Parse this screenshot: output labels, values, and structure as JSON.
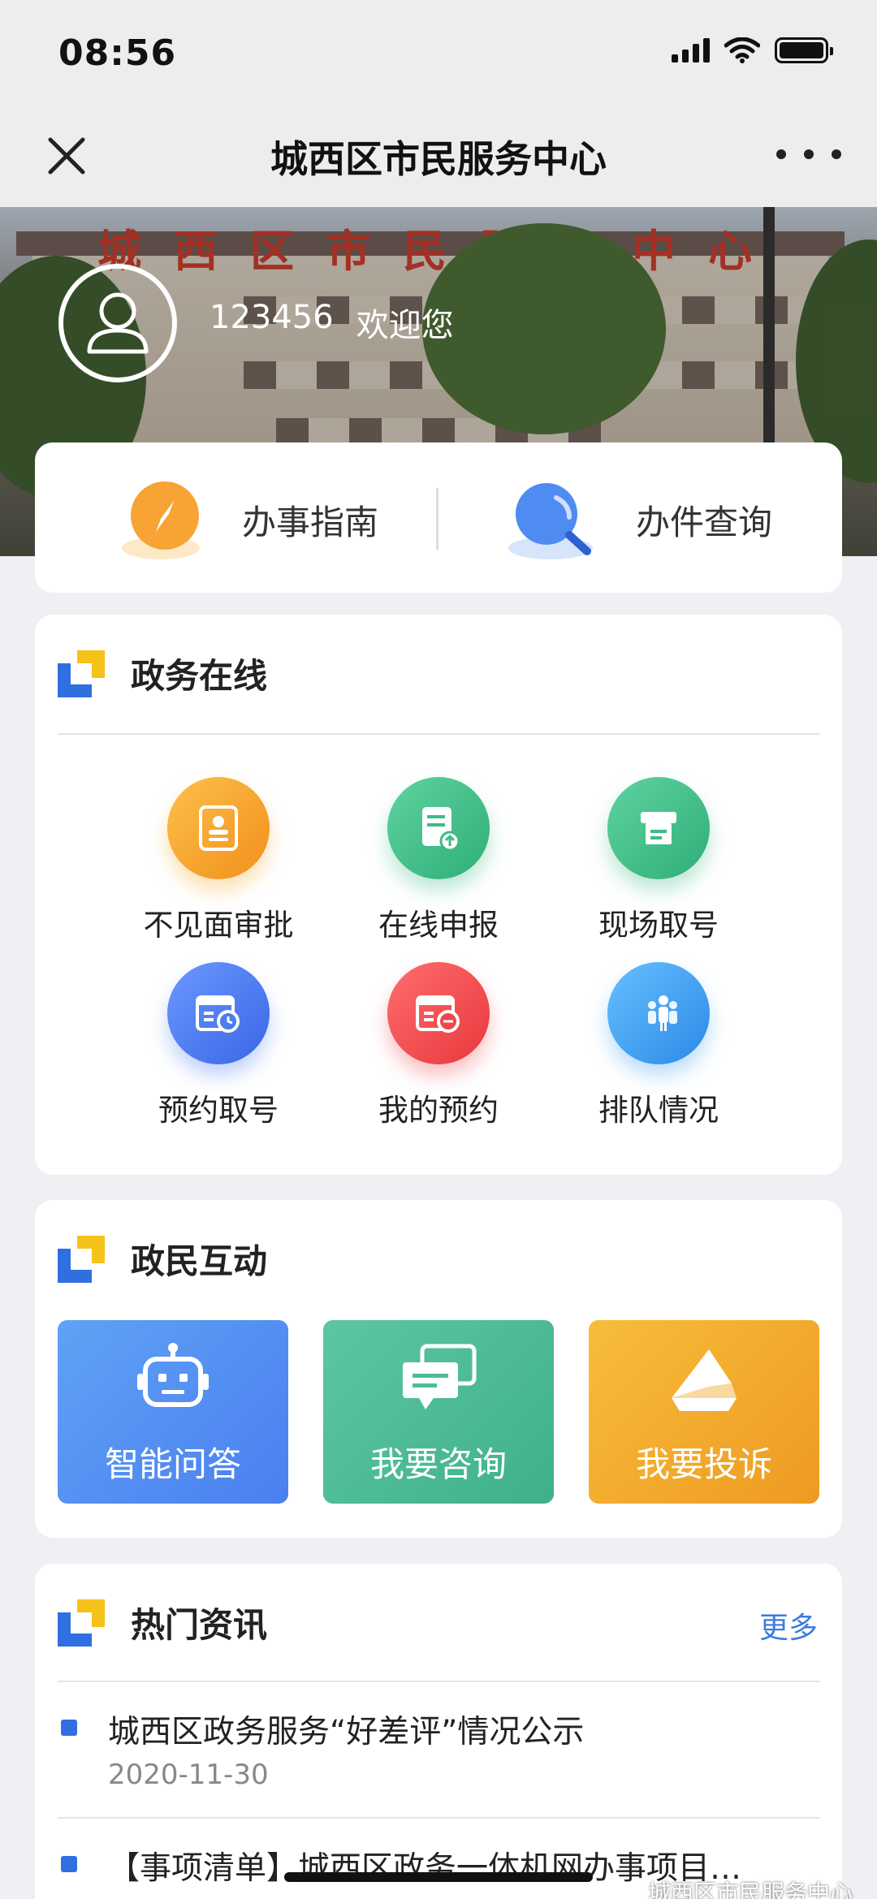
{
  "status_bar": {
    "time": "08:56"
  },
  "nav": {
    "title": "城西区市民服务中心"
  },
  "hero": {
    "sign_text": "城西区市民服务中心",
    "user_id": "123456",
    "welcome": "欢迎您"
  },
  "quick_actions": [
    {
      "label": "办事指南",
      "icon": "compass-icon"
    },
    {
      "label": "办件查询",
      "icon": "magnifier-icon"
    }
  ],
  "gov_online": {
    "title": "政务在线",
    "items": [
      {
        "label": "不见面审批",
        "icon": "id-card-icon",
        "color": "#f5a623"
      },
      {
        "label": "在线申报",
        "icon": "document-upload-icon",
        "color": "#3dbb86"
      },
      {
        "label": "现场取号",
        "icon": "ticket-machine-icon",
        "color": "#3dbb86"
      },
      {
        "label": "预约取号",
        "icon": "calendar-clock-icon",
        "color": "#4a7df0"
      },
      {
        "label": "我的预约",
        "icon": "calendar-minus-icon",
        "color": "#f0474b"
      },
      {
        "label": "排队情况",
        "icon": "people-queue-icon",
        "color": "#3d9ef0"
      }
    ]
  },
  "interaction": {
    "title": "政民互动",
    "tiles": [
      {
        "label": "智能问答",
        "icon": "robot-icon",
        "color": "#4d8ff0"
      },
      {
        "label": "我要咨询",
        "icon": "chat-bubbles-icon",
        "color": "#4dbd97"
      },
      {
        "label": "我要投诉",
        "icon": "envelope-icon",
        "color": "#f3a92c"
      }
    ]
  },
  "news": {
    "title": "热门资讯",
    "more": "更多",
    "items": [
      {
        "title": "城西区政务服务“好差评”情况公示",
        "date": "2020-11-30"
      },
      {
        "title": "【事项清单】城西区政务一体机网办事项目…",
        "date": ""
      }
    ]
  },
  "watermark": "城西区市民服务中心"
}
